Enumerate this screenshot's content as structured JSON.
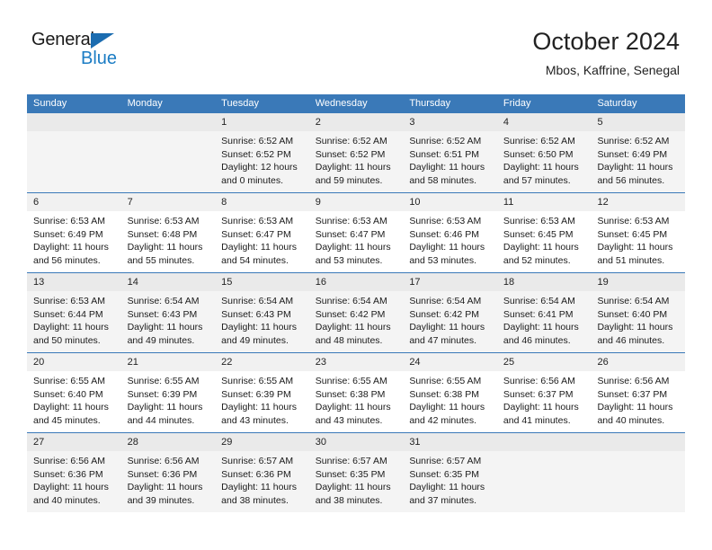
{
  "brand": {
    "name_part1": "General",
    "name_part2": "Blue",
    "triangle_color": "#1b6cb0",
    "blue_color": "#1b7cc4"
  },
  "header": {
    "title": "October 2024",
    "subtitle": "Mbos, Kaffrine, Senegal"
  },
  "theme": {
    "header_blue": "#3a79b8",
    "daynum_band": "#f1f1f1",
    "shaded_row": "#f4f4f4"
  },
  "weekdays": [
    "Sunday",
    "Monday",
    "Tuesday",
    "Wednesday",
    "Thursday",
    "Friday",
    "Saturday"
  ],
  "weeks": [
    {
      "shaded": true,
      "days": [
        {
          "day": "",
          "sunrise": "",
          "sunset": "",
          "daylight": ""
        },
        {
          "day": "",
          "sunrise": "",
          "sunset": "",
          "daylight": ""
        },
        {
          "day": "1",
          "sunrise": "Sunrise: 6:52 AM",
          "sunset": "Sunset: 6:52 PM",
          "daylight": "Daylight: 12 hours and 0 minutes."
        },
        {
          "day": "2",
          "sunrise": "Sunrise: 6:52 AM",
          "sunset": "Sunset: 6:52 PM",
          "daylight": "Daylight: 11 hours and 59 minutes."
        },
        {
          "day": "3",
          "sunrise": "Sunrise: 6:52 AM",
          "sunset": "Sunset: 6:51 PM",
          "daylight": "Daylight: 11 hours and 58 minutes."
        },
        {
          "day": "4",
          "sunrise": "Sunrise: 6:52 AM",
          "sunset": "Sunset: 6:50 PM",
          "daylight": "Daylight: 11 hours and 57 minutes."
        },
        {
          "day": "5",
          "sunrise": "Sunrise: 6:52 AM",
          "sunset": "Sunset: 6:49 PM",
          "daylight": "Daylight: 11 hours and 56 minutes."
        }
      ]
    },
    {
      "shaded": false,
      "days": [
        {
          "day": "6",
          "sunrise": "Sunrise: 6:53 AM",
          "sunset": "Sunset: 6:49 PM",
          "daylight": "Daylight: 11 hours and 56 minutes."
        },
        {
          "day": "7",
          "sunrise": "Sunrise: 6:53 AM",
          "sunset": "Sunset: 6:48 PM",
          "daylight": "Daylight: 11 hours and 55 minutes."
        },
        {
          "day": "8",
          "sunrise": "Sunrise: 6:53 AM",
          "sunset": "Sunset: 6:47 PM",
          "daylight": "Daylight: 11 hours and 54 minutes."
        },
        {
          "day": "9",
          "sunrise": "Sunrise: 6:53 AM",
          "sunset": "Sunset: 6:47 PM",
          "daylight": "Daylight: 11 hours and 53 minutes."
        },
        {
          "day": "10",
          "sunrise": "Sunrise: 6:53 AM",
          "sunset": "Sunset: 6:46 PM",
          "daylight": "Daylight: 11 hours and 53 minutes."
        },
        {
          "day": "11",
          "sunrise": "Sunrise: 6:53 AM",
          "sunset": "Sunset: 6:45 PM",
          "daylight": "Daylight: 11 hours and 52 minutes."
        },
        {
          "day": "12",
          "sunrise": "Sunrise: 6:53 AM",
          "sunset": "Sunset: 6:45 PM",
          "daylight": "Daylight: 11 hours and 51 minutes."
        }
      ]
    },
    {
      "shaded": true,
      "days": [
        {
          "day": "13",
          "sunrise": "Sunrise: 6:53 AM",
          "sunset": "Sunset: 6:44 PM",
          "daylight": "Daylight: 11 hours and 50 minutes."
        },
        {
          "day": "14",
          "sunrise": "Sunrise: 6:54 AM",
          "sunset": "Sunset: 6:43 PM",
          "daylight": "Daylight: 11 hours and 49 minutes."
        },
        {
          "day": "15",
          "sunrise": "Sunrise: 6:54 AM",
          "sunset": "Sunset: 6:43 PM",
          "daylight": "Daylight: 11 hours and 49 minutes."
        },
        {
          "day": "16",
          "sunrise": "Sunrise: 6:54 AM",
          "sunset": "Sunset: 6:42 PM",
          "daylight": "Daylight: 11 hours and 48 minutes."
        },
        {
          "day": "17",
          "sunrise": "Sunrise: 6:54 AM",
          "sunset": "Sunset: 6:42 PM",
          "daylight": "Daylight: 11 hours and 47 minutes."
        },
        {
          "day": "18",
          "sunrise": "Sunrise: 6:54 AM",
          "sunset": "Sunset: 6:41 PM",
          "daylight": "Daylight: 11 hours and 46 minutes."
        },
        {
          "day": "19",
          "sunrise": "Sunrise: 6:54 AM",
          "sunset": "Sunset: 6:40 PM",
          "daylight": "Daylight: 11 hours and 46 minutes."
        }
      ]
    },
    {
      "shaded": false,
      "days": [
        {
          "day": "20",
          "sunrise": "Sunrise: 6:55 AM",
          "sunset": "Sunset: 6:40 PM",
          "daylight": "Daylight: 11 hours and 45 minutes."
        },
        {
          "day": "21",
          "sunrise": "Sunrise: 6:55 AM",
          "sunset": "Sunset: 6:39 PM",
          "daylight": "Daylight: 11 hours and 44 minutes."
        },
        {
          "day": "22",
          "sunrise": "Sunrise: 6:55 AM",
          "sunset": "Sunset: 6:39 PM",
          "daylight": "Daylight: 11 hours and 43 minutes."
        },
        {
          "day": "23",
          "sunrise": "Sunrise: 6:55 AM",
          "sunset": "Sunset: 6:38 PM",
          "daylight": "Daylight: 11 hours and 43 minutes."
        },
        {
          "day": "24",
          "sunrise": "Sunrise: 6:55 AM",
          "sunset": "Sunset: 6:38 PM",
          "daylight": "Daylight: 11 hours and 42 minutes."
        },
        {
          "day": "25",
          "sunrise": "Sunrise: 6:56 AM",
          "sunset": "Sunset: 6:37 PM",
          "daylight": "Daylight: 11 hours and 41 minutes."
        },
        {
          "day": "26",
          "sunrise": "Sunrise: 6:56 AM",
          "sunset": "Sunset: 6:37 PM",
          "daylight": "Daylight: 11 hours and 40 minutes."
        }
      ]
    },
    {
      "shaded": true,
      "days": [
        {
          "day": "27",
          "sunrise": "Sunrise: 6:56 AM",
          "sunset": "Sunset: 6:36 PM",
          "daylight": "Daylight: 11 hours and 40 minutes."
        },
        {
          "day": "28",
          "sunrise": "Sunrise: 6:56 AM",
          "sunset": "Sunset: 6:36 PM",
          "daylight": "Daylight: 11 hours and 39 minutes."
        },
        {
          "day": "29",
          "sunrise": "Sunrise: 6:57 AM",
          "sunset": "Sunset: 6:36 PM",
          "daylight": "Daylight: 11 hours and 38 minutes."
        },
        {
          "day": "30",
          "sunrise": "Sunrise: 6:57 AM",
          "sunset": "Sunset: 6:35 PM",
          "daylight": "Daylight: 11 hours and 38 minutes."
        },
        {
          "day": "31",
          "sunrise": "Sunrise: 6:57 AM",
          "sunset": "Sunset: 6:35 PM",
          "daylight": "Daylight: 11 hours and 37 minutes."
        },
        {
          "day": "",
          "sunrise": "",
          "sunset": "",
          "daylight": ""
        },
        {
          "day": "",
          "sunrise": "",
          "sunset": "",
          "daylight": ""
        }
      ]
    }
  ]
}
